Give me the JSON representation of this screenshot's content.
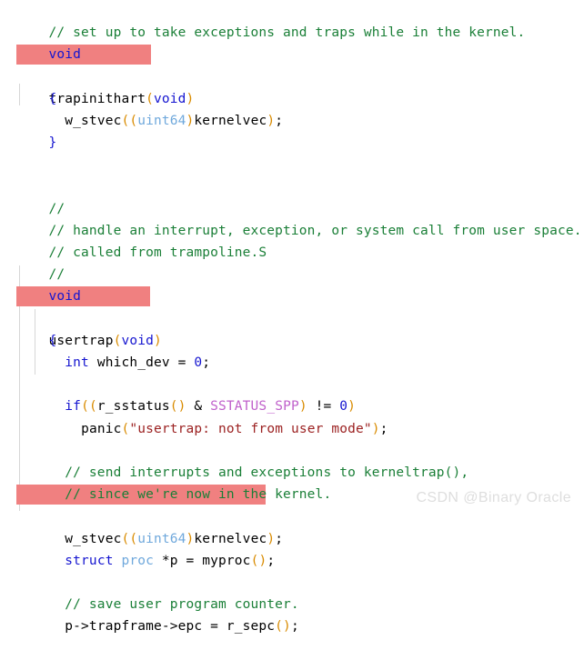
{
  "editor": {
    "language": "c",
    "background_color": "#ffffff",
    "highlight_color": "#f08080",
    "indent_guide_color": "#d7d7d7",
    "token_colors": {
      "comment": "#1a7f37",
      "keyword": "#1515d0",
      "type": "#6fa8dc",
      "parenthesis": "#d98b00",
      "macro": "#c061cb",
      "string": "#9c2222",
      "number": "#1515d0",
      "plain": "#000000"
    }
  },
  "lines": [
    {
      "n": 1,
      "text": "// set up to take exceptions and traps while in the kernel."
    },
    {
      "n": 2,
      "text": "void"
    },
    {
      "n": 3,
      "text": "trapinithart(void)",
      "highlighted": true
    },
    {
      "n": 4,
      "text": "{"
    },
    {
      "n": 5,
      "text": "  w_stvec((uint64)kernelvec);"
    },
    {
      "n": 6,
      "text": "}"
    },
    {
      "n": 7,
      "text": ""
    },
    {
      "n": 8,
      "text": ""
    },
    {
      "n": 9,
      "text": "//"
    },
    {
      "n": 10,
      "text": "// handle an interrupt, exception, or system call from user space."
    },
    {
      "n": 11,
      "text": "// called from trampoline.S"
    },
    {
      "n": 12,
      "text": "//"
    },
    {
      "n": 13,
      "text": "void"
    },
    {
      "n": 14,
      "text": "usertrap(void)",
      "highlighted": true
    },
    {
      "n": 15,
      "text": "{"
    },
    {
      "n": 16,
      "text": "  int which_dev = 0;"
    },
    {
      "n": 17,
      "text": ""
    },
    {
      "n": 18,
      "text": "  if((r_sstatus() & SSTATUS_SPP) != 0)"
    },
    {
      "n": 19,
      "text": "    panic(\"usertrap: not from user mode\");"
    },
    {
      "n": 20,
      "text": ""
    },
    {
      "n": 21,
      "text": "  // send interrupts and exceptions to kerneltrap(),"
    },
    {
      "n": 22,
      "text": "  // since we're now in the kernel."
    },
    {
      "n": 23,
      "text": "  w_stvec((uint64)kernelvec);",
      "highlighted": true
    },
    {
      "n": 24,
      "text": ""
    },
    {
      "n": 25,
      "text": "  struct proc *p = myproc();"
    },
    {
      "n": 26,
      "text": ""
    },
    {
      "n": 27,
      "text": "  // save user program counter."
    },
    {
      "n": 28,
      "text": "  p->trapframe->epc = r_sepc();"
    },
    {
      "n": 29,
      "text": ""
    }
  ],
  "watermark": {
    "text": "CSDN @Binary Oracle",
    "color": "#dedede"
  }
}
